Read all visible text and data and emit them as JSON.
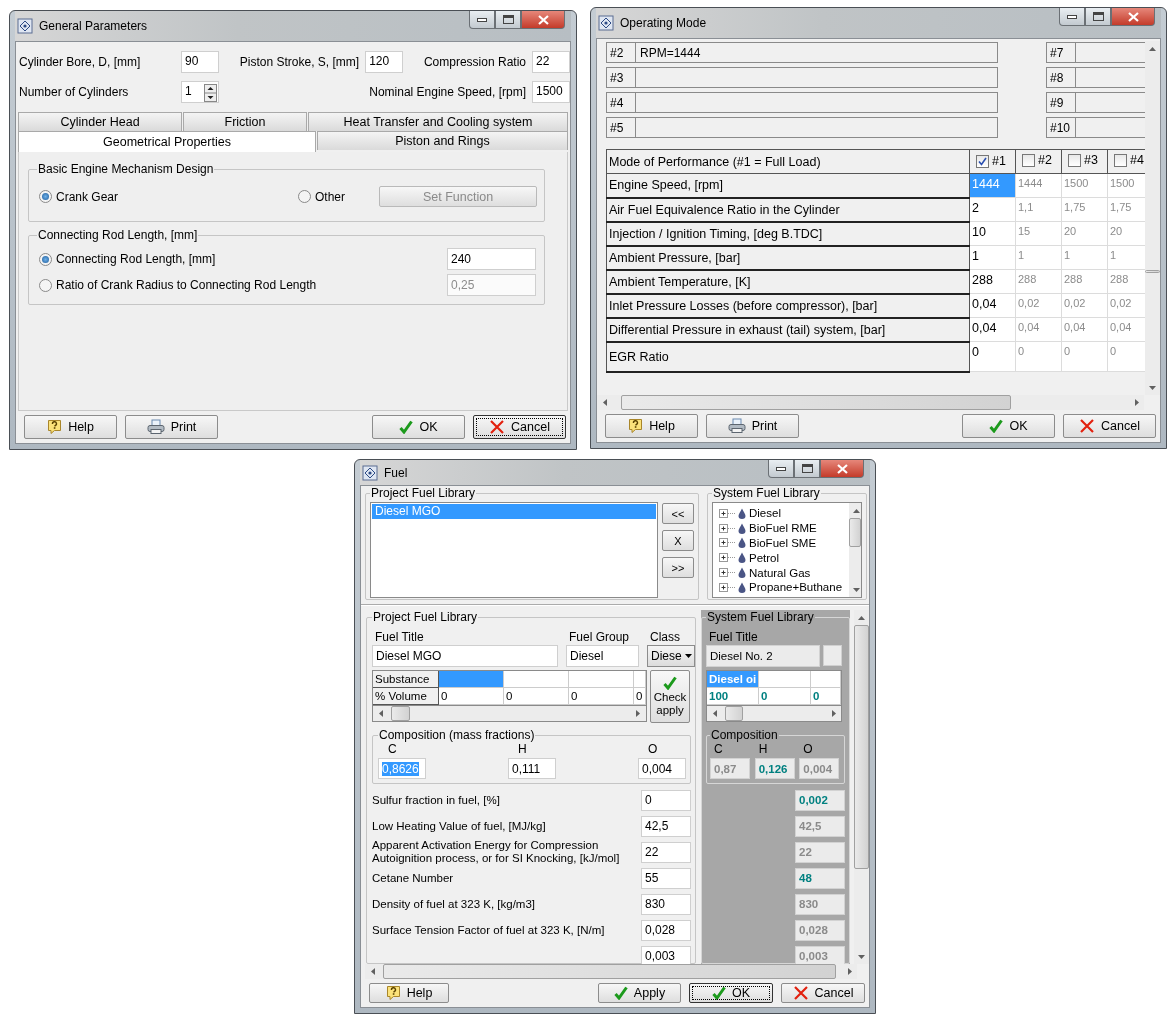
{
  "general_parameters": {
    "title": "General Parameters",
    "field_rows": [
      [
        {
          "label": "Cylinder Bore, D, [mm]",
          "value": "90",
          "kind": "text"
        },
        {
          "label": "Piston Stroke, S, [mm]",
          "value": "120",
          "kind": "text"
        },
        {
          "label": "Compression Ratio",
          "value": "22",
          "kind": "text"
        }
      ],
      [
        {
          "label": "Number of Cylinders",
          "value": "1",
          "kind": "spin"
        },
        {
          "label": "Nominal Engine Speed, [rpm]",
          "value": "1500",
          "kind": "text"
        }
      ]
    ],
    "tab_rows": [
      [
        {
          "label": "Cylinder Head",
          "selected": false
        },
        {
          "label": "Friction",
          "selected": false
        },
        {
          "label": "Heat Transfer and Cooling system",
          "selected": false
        }
      ],
      [
        {
          "label": "Geometrical Properties",
          "selected": true
        },
        {
          "label": "Piston and Rings",
          "selected": false
        }
      ]
    ],
    "mechanism_group": {
      "title": "Basic Engine Mechanism Design",
      "options": [
        {
          "label": "Crank Gear",
          "selected": true
        },
        {
          "label": "Other",
          "selected": false
        }
      ],
      "set_function_button": {
        "label": "Set Function",
        "disabled": true
      }
    },
    "rod_group": {
      "title": "Connecting Rod Length, [mm]",
      "options": [
        {
          "label": "Connecting Rod Length, [mm]",
          "selected": true,
          "value": "240"
        },
        {
          "label": "Ratio of Crank Radius to Connecting Rod Length",
          "selected": false,
          "value": "0,25"
        }
      ]
    },
    "buttons": [
      {
        "kind": "help",
        "label": "Help",
        "focused": false
      },
      {
        "kind": "print",
        "label": "Print",
        "focused": false
      },
      {
        "kind": "ok",
        "label": "OK",
        "focused": false
      },
      {
        "kind": "cancel",
        "label": "Cancel",
        "focused": true
      }
    ]
  },
  "operating_mode": {
    "title": "Operating Mode",
    "notes_left": [
      {
        "label": "#2",
        "text": "RPM=1444"
      },
      {
        "label": "#3"
      },
      {
        "label": "#4"
      },
      {
        "label": "#5"
      }
    ],
    "notes_right": [
      {
        "label": "#7"
      },
      {
        "label": "#8"
      },
      {
        "label": "#9"
      },
      {
        "label": "#10"
      }
    ],
    "table": {
      "header": "Mode of Performance (#1 = Full Load)",
      "modes": [
        {
          "label": "#1",
          "checked": true
        },
        {
          "label": "#2",
          "checked": false
        },
        {
          "label": "#3",
          "checked": false
        },
        {
          "label": "#4",
          "checked": false
        }
      ],
      "rows": [
        {
          "label": "Engine Speed, [rpm]",
          "cells": [
            {
              "text": "1444",
              "selected": true
            },
            {
              "text": "1444",
              "selected": false
            },
            {
              "text": "1500",
              "selected": false
            },
            {
              "text": "1500",
              "selected": false
            }
          ]
        },
        {
          "label": "Air Fuel Equivalence Ratio in the Cylinder",
          "cells": [
            {
              "text": "2",
              "selected": false
            },
            {
              "text": "1,1",
              "selected": false
            },
            {
              "text": "1,75",
              "selected": false
            },
            {
              "text": "1,75",
              "selected": false
            }
          ]
        },
        {
          "label": "Injection / Ignition Timing, [deg B.TDC]",
          "cells": [
            {
              "text": "10",
              "selected": false
            },
            {
              "text": "15",
              "selected": false
            },
            {
              "text": "20",
              "selected": false
            },
            {
              "text": "20",
              "selected": false
            }
          ]
        },
        {
          "label": "Ambient Pressure, [bar]",
          "cells": [
            {
              "text": "1",
              "selected": false
            },
            {
              "text": "1",
              "selected": false
            },
            {
              "text": "1",
              "selected": false
            },
            {
              "text": "1",
              "selected": false
            }
          ]
        },
        {
          "label": "Ambient Temperature, [K]",
          "cells": [
            {
              "text": "288",
              "selected": false
            },
            {
              "text": "288",
              "selected": false
            },
            {
              "text": "288",
              "selected": false
            },
            {
              "text": "288",
              "selected": false
            }
          ]
        },
        {
          "label": "Inlet Pressure Losses (before compressor), [bar]",
          "cells": [
            {
              "text": "0,04",
              "selected": false
            },
            {
              "text": "0,02",
              "selected": false
            },
            {
              "text": "0,02",
              "selected": false
            },
            {
              "text": "0,02",
              "selected": false
            }
          ]
        },
        {
          "label": "Differential Pressure in exhaust (tail) system, [bar]",
          "cells": [
            {
              "text": "0,04",
              "selected": false
            },
            {
              "text": "0,04",
              "selected": false
            },
            {
              "text": "0,04",
              "selected": false
            },
            {
              "text": "0,04",
              "selected": false
            }
          ]
        },
        {
          "label": "EGR Ratio",
          "cells": [
            {
              "text": "0",
              "selected": false
            },
            {
              "text": "0",
              "selected": false
            },
            {
              "text": "0",
              "selected": false
            },
            {
              "text": "0",
              "selected": false
            }
          ]
        }
      ]
    },
    "buttons": [
      {
        "kind": "help",
        "label": "Help",
        "focused": false
      },
      {
        "kind": "print",
        "label": "Print",
        "focused": false
      },
      {
        "kind": "ok",
        "label": "OK",
        "focused": false
      },
      {
        "kind": "cancel",
        "label": "Cancel",
        "focused": false
      }
    ]
  },
  "fuel": {
    "title": "Fuel",
    "project_library": {
      "title": "Project Fuel Library",
      "items": [
        {
          "label": "Diesel MGO",
          "selected": true
        }
      ]
    },
    "transfer_buttons": [
      "<<",
      "X",
      ">>"
    ],
    "system_library": {
      "title": "System Fuel Library",
      "items": [
        "Diesel",
        "BioFuel RME",
        "BioFuel SME",
        "Petrol",
        "Natural Gas",
        "Propane+Buthane"
      ]
    },
    "project_details": {
      "title": "Project Fuel Library",
      "fuel_title": {
        "label": "Fuel Title",
        "value": "Diesel MGO"
      },
      "fuel_group": {
        "label": "Fuel Group",
        "value": "Diesel"
      },
      "class": {
        "label": "Class",
        "value": "Diese"
      },
      "substance_table": {
        "row_labels": [
          "Substance",
          "% Volume"
        ],
        "columns": [
          {
            "volume": "0",
            "selected": true
          },
          {
            "volume": "0",
            "selected": false
          },
          {
            "volume": "0",
            "selected": false
          },
          {
            "volume": "0",
            "selected": false
          }
        ]
      },
      "check_button": "Check apply",
      "composition": {
        "title": "Composition (mass fractions)",
        "components": [
          {
            "label": "C",
            "value": "0,8626",
            "selected": true
          },
          {
            "label": "H",
            "value": "0,111",
            "selected": false
          },
          {
            "label": "O",
            "value": "0,004",
            "selected": false
          }
        ]
      }
    },
    "system_details": {
      "title": "System Fuel Library",
      "fuel_title": {
        "label": "Fuel Title",
        "value": "Diesel No. 2"
      },
      "substance_table": {
        "columns": [
          {
            "substance": "Diesel oi",
            "volume": "100",
            "selected": true
          },
          {
            "volume": "0",
            "selected": false
          },
          {
            "volume": "0",
            "selected": false
          }
        ]
      },
      "composition": {
        "title": "Composition",
        "components": [
          {
            "label": "C",
            "value": "0,87",
            "highlight": false
          },
          {
            "label": "H",
            "value": "0,126",
            "highlight": true
          },
          {
            "label": "O",
            "value": "0,004",
            "highlight": false
          }
        ]
      }
    },
    "properties": [
      {
        "label": "Sulfur fraction in fuel, [%]",
        "value": "0",
        "system_value": "0,002",
        "highlight": true
      },
      {
        "label": "Low Heating Value of fuel, [MJ/kg]",
        "value": "42,5",
        "system_value": "42,5",
        "highlight": false
      },
      {
        "label": "Apparent Activation Energy for Compression Autoignition process, or for SI Knocking, [kJ/mol]",
        "value": "22",
        "system_value": "22",
        "highlight": false
      },
      {
        "label": "Cetane Number",
        "value": "55",
        "system_value": "48",
        "highlight": true
      },
      {
        "label": "Density of fuel at 323 K, [kg/m3]",
        "value": "830",
        "system_value": "830",
        "highlight": false
      },
      {
        "label": "Surface Tension Factor of fuel at 323 K, [N/m]",
        "value": "0,028",
        "system_value": "0,028",
        "highlight": false
      },
      {
        "value": "0,003",
        "system_value": "0,003",
        "highlight": false
      }
    ],
    "buttons": [
      {
        "kind": "help",
        "label": "Help",
        "focused": false
      },
      {
        "kind": "apply",
        "label": "Apply",
        "focused": false
      },
      {
        "kind": "ok",
        "label": "OK",
        "focused": true
      },
      {
        "kind": "cancel",
        "label": "Cancel",
        "focused": false
      }
    ]
  }
}
